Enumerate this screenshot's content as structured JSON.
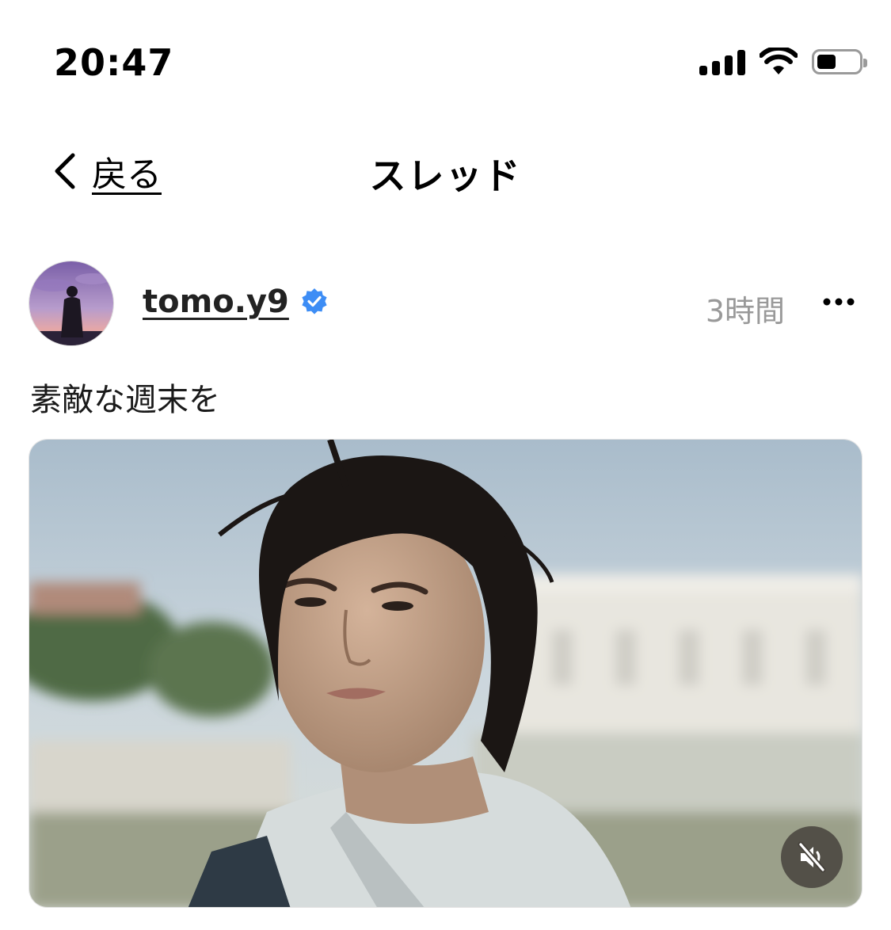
{
  "status_bar": {
    "time": "20:47",
    "icons": [
      "signal-icon",
      "wifi-icon",
      "battery-icon"
    ],
    "battery_level": 0.45
  },
  "nav": {
    "back_label": "戻る",
    "title": "スレッド"
  },
  "post": {
    "username": "tomo.y9",
    "verified": true,
    "timestamp": "3時間",
    "text": "素敵な週末を",
    "media_type": "video",
    "muted": true
  },
  "colors": {
    "verified_badge": "#3d8df5",
    "timestamp": "#999999",
    "mute_button_bg": "#46423c"
  }
}
